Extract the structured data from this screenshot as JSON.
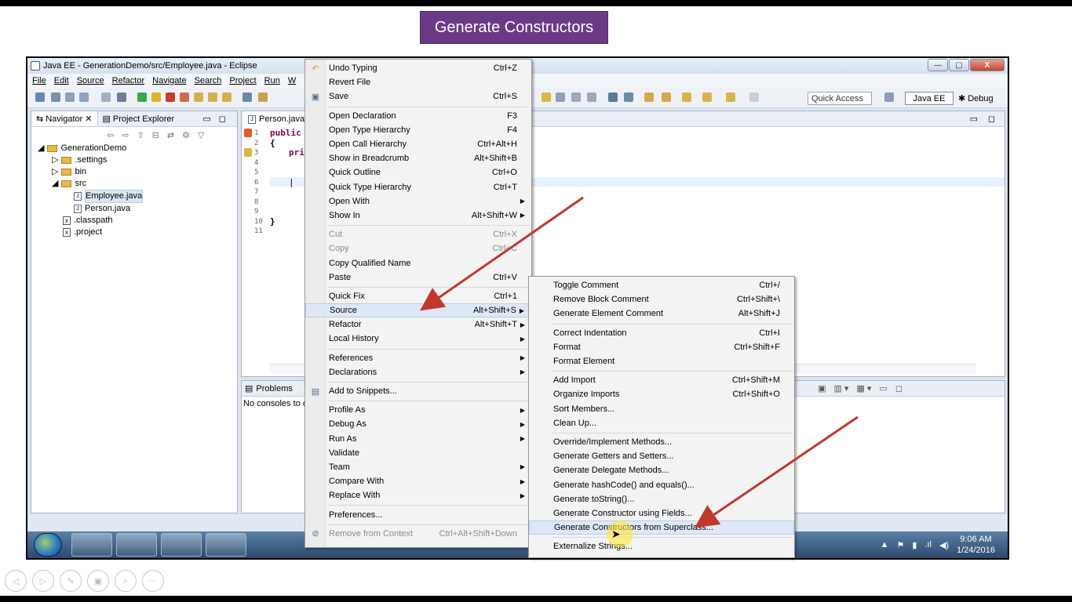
{
  "banner": {
    "text": "Generate Constructors"
  },
  "window": {
    "title": "Java EE - GenerationDemo/src/Employee.java - Eclipse",
    "controls": {
      "minimize": "—",
      "maximize": "▢",
      "close": "X"
    }
  },
  "menubar": [
    "File",
    "Edit",
    "Source",
    "Refactor",
    "Navigate",
    "Search",
    "Project",
    "Run",
    "W"
  ],
  "toolbar": {
    "quick_access": "Quick Access",
    "perspective_java_ee": "Java EE",
    "perspective_debug": "Debug"
  },
  "navigator": {
    "tabs": [
      "Navigator",
      "Project Explorer"
    ],
    "tree": [
      {
        "label": "GenerationDemo",
        "type": "project"
      },
      {
        "label": ".settings",
        "type": "folder"
      },
      {
        "label": "bin",
        "type": "folder"
      },
      {
        "label": "src",
        "type": "folder"
      },
      {
        "label": "Employee.java",
        "type": "java"
      },
      {
        "label": "Person.java",
        "type": "java"
      },
      {
        "label": ".classpath",
        "type": "xml"
      },
      {
        "label": ".project",
        "type": "xml"
      }
    ]
  },
  "editor": {
    "tab": "Person.java",
    "line_numbers": [
      "1",
      "2",
      "3",
      "4",
      "5",
      "6",
      "7",
      "8",
      "9",
      "10",
      "11"
    ],
    "code_line1": "public",
    "code_line2": "{",
    "code_line3": "pri",
    "code_line10": "}"
  },
  "console": {
    "tab": "Problems",
    "text": "No consoles to d"
  },
  "context_menu": [
    {
      "label": "Undo Typing",
      "shortcut": "Ctrl+Z",
      "icon": "undo-icon"
    },
    {
      "label": "Revert File"
    },
    {
      "label": "Save",
      "shortcut": "Ctrl+S",
      "icon": "save-icon"
    },
    {
      "sep": true
    },
    {
      "label": "Open Declaration",
      "shortcut": "F3"
    },
    {
      "label": "Open Type Hierarchy",
      "shortcut": "F4"
    },
    {
      "label": "Open Call Hierarchy",
      "shortcut": "Ctrl+Alt+H"
    },
    {
      "label": "Show in Breadcrumb",
      "shortcut": "Alt+Shift+B"
    },
    {
      "label": "Quick Outline",
      "shortcut": "Ctrl+O"
    },
    {
      "label": "Quick Type Hierarchy",
      "shortcut": "Ctrl+T"
    },
    {
      "label": "Open With",
      "submenu": true
    },
    {
      "label": "Show In",
      "shortcut": "Alt+Shift+W",
      "submenu": true
    },
    {
      "sep": true
    },
    {
      "label": "Cut",
      "shortcut": "Ctrl+X",
      "disabled": true
    },
    {
      "label": "Copy",
      "shortcut": "Ctrl+C",
      "disabled": true
    },
    {
      "label": "Copy Qualified Name"
    },
    {
      "label": "Paste",
      "shortcut": "Ctrl+V"
    },
    {
      "sep": true
    },
    {
      "label": "Quick Fix",
      "shortcut": "Ctrl+1"
    },
    {
      "label": "Source",
      "shortcut": "Alt+Shift+S",
      "submenu": true,
      "highlighted": true
    },
    {
      "label": "Refactor",
      "shortcut": "Alt+Shift+T",
      "submenu": true
    },
    {
      "label": "Local History",
      "submenu": true
    },
    {
      "sep": true
    },
    {
      "label": "References",
      "submenu": true
    },
    {
      "label": "Declarations",
      "submenu": true
    },
    {
      "sep": true
    },
    {
      "label": "Add to Snippets...",
      "icon": "snippet-icon"
    },
    {
      "sep": true
    },
    {
      "label": "Profile As",
      "submenu": true
    },
    {
      "label": "Debug As",
      "submenu": true
    },
    {
      "label": "Run As",
      "submenu": true
    },
    {
      "label": "Validate"
    },
    {
      "label": "Team",
      "submenu": true
    },
    {
      "label": "Compare With",
      "submenu": true
    },
    {
      "label": "Replace With",
      "submenu": true
    },
    {
      "sep": true
    },
    {
      "label": "Preferences..."
    },
    {
      "sep": true
    },
    {
      "label": "Remove from Context",
      "shortcut": "Ctrl+Alt+Shift+Down",
      "disabled": true,
      "icon": "remove-context-icon"
    }
  ],
  "source_submenu": [
    {
      "label": "Toggle Comment",
      "shortcut": "Ctrl+/"
    },
    {
      "label": "Remove Block Comment",
      "shortcut": "Ctrl+Shift+\\"
    },
    {
      "label": "Generate Element Comment",
      "shortcut": "Alt+Shift+J"
    },
    {
      "sep": true
    },
    {
      "label": "Correct Indentation",
      "shortcut": "Ctrl+I"
    },
    {
      "label": "Format",
      "shortcut": "Ctrl+Shift+F"
    },
    {
      "label": "Format Element"
    },
    {
      "sep": true
    },
    {
      "label": "Add Import",
      "shortcut": "Ctrl+Shift+M"
    },
    {
      "label": "Organize Imports",
      "shortcut": "Ctrl+Shift+O"
    },
    {
      "label": "Sort Members..."
    },
    {
      "label": "Clean Up..."
    },
    {
      "sep": true
    },
    {
      "label": "Override/Implement Methods..."
    },
    {
      "label": "Generate Getters and Setters..."
    },
    {
      "label": "Generate Delegate Methods..."
    },
    {
      "label": "Generate hashCode() and equals()..."
    },
    {
      "label": "Generate toString()..."
    },
    {
      "label": "Generate Constructor using Fields..."
    },
    {
      "label": "Generate Constructors from Superclass...",
      "highlighted": true
    },
    {
      "sep": true
    },
    {
      "label": "Externalize Strings..."
    }
  ],
  "taskbar": {
    "time": "9:06 AM",
    "date": "1/24/2016"
  },
  "colors": {
    "banner": "#6b3a86",
    "arrow": "#c0392b",
    "highlight": "#dde8f7"
  }
}
